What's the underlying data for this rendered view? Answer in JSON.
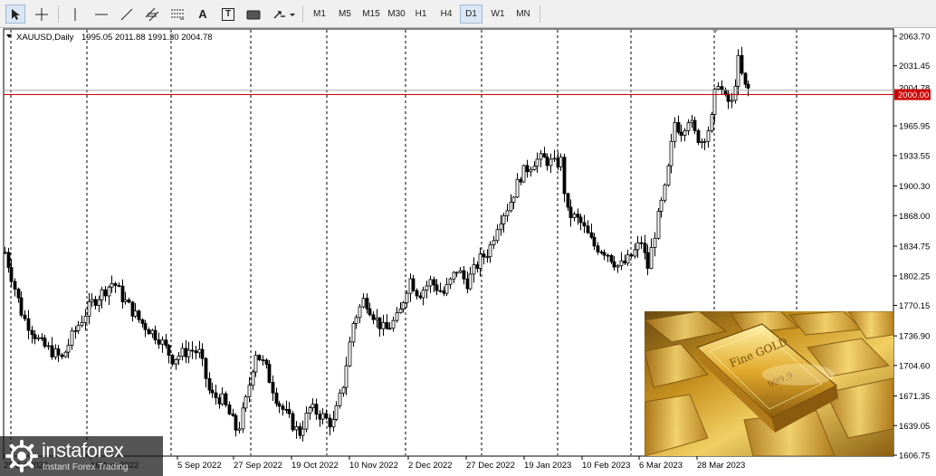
{
  "toolbar": {
    "tools": [
      "cursor-icon",
      "crosshair-icon",
      "vertical-line-icon",
      "horizontal-line-icon",
      "trendline-icon",
      "channel-icon",
      "fibonacci-icon",
      "text-icon",
      "text-label-icon",
      "shapes-icon",
      "arrows-icon"
    ],
    "text_tool_label": "A",
    "text_label_tool_label": "T",
    "timeframes": [
      "M1",
      "M5",
      "M15",
      "M30",
      "H1",
      "H4",
      "D1",
      "W1",
      "MN"
    ],
    "active_timeframe": "D1"
  },
  "chart_header": {
    "symbol": "XAUUSD,Daily",
    "ohlc": "1995.05 2011.88 1991.30 2004.78"
  },
  "chart_data": {
    "type": "candlestick",
    "symbol": "XAUUSD,Daily",
    "open": 1995.05,
    "high": 2011.88,
    "low": 1991.3,
    "close": 2004.78,
    "y_ticks": [
      2063.7,
      2031.45,
      1965.95,
      1933.55,
      1900.3,
      1868.0,
      1834.75,
      1802.25,
      1770.15,
      1736.9,
      1704.6,
      1671.35,
      1639.05,
      1606.75
    ],
    "y_ticks_labels": [
      "2063.70",
      "2031.45",
      "1965.95",
      "1933.55",
      "1900.30",
      "1868.00",
      "1834.75",
      "1802.25",
      "1770.15",
      "1736.90",
      "1704.60",
      "1671.35",
      "1639.05",
      "1606.75"
    ],
    "ylim": [
      1606.75,
      2063.7
    ],
    "x_tick_labels": [
      "25 Jul 2022",
      "16 Aug 2022",
      "5 Sep 2022",
      "27 Sep 2022",
      "19 Oct 2022",
      "10 Nov 2022",
      "2 Dec 2022",
      "27 Dec 2022",
      "19 Jan 2023",
      "10 Feb 2023",
      "6 Mar 2023",
      "28 Mar 2023"
    ],
    "level_line": 2000.0,
    "level_line_label": "2000.00",
    "last_price_label": "2004.78",
    "level_line_color": "#cc0000",
    "up_color": "#ffffff",
    "down_color": "#000000",
    "grid": "vertical dashed",
    "anchors": [
      {
        "x": 5,
        "y": 1828
      },
      {
        "x": 25,
        "y": 1758
      },
      {
        "x": 45,
        "y": 1728
      },
      {
        "x": 68,
        "y": 1712
      },
      {
        "x": 80,
        "y": 1738
      },
      {
        "x": 100,
        "y": 1772
      },
      {
        "x": 125,
        "y": 1796
      },
      {
        "x": 135,
        "y": 1778
      },
      {
        "x": 155,
        "y": 1752
      },
      {
        "x": 175,
        "y": 1735
      },
      {
        "x": 190,
        "y": 1712
      },
      {
        "x": 210,
        "y": 1722
      },
      {
        "x": 220,
        "y": 1718
      },
      {
        "x": 232,
        "y": 1672
      },
      {
        "x": 245,
        "y": 1668
      },
      {
        "x": 262,
        "y": 1632
      },
      {
        "x": 272,
        "y": 1668
      },
      {
        "x": 282,
        "y": 1720
      },
      {
        "x": 293,
        "y": 1702
      },
      {
        "x": 306,
        "y": 1666
      },
      {
        "x": 318,
        "y": 1648
      },
      {
        "x": 330,
        "y": 1630
      },
      {
        "x": 342,
        "y": 1658
      },
      {
        "x": 355,
        "y": 1650
      },
      {
        "x": 367,
        "y": 1640
      },
      {
        "x": 378,
        "y": 1680
      },
      {
        "x": 390,
        "y": 1752
      },
      {
        "x": 402,
        "y": 1778
      },
      {
        "x": 415,
        "y": 1755
      },
      {
        "x": 425,
        "y": 1742
      },
      {
        "x": 440,
        "y": 1758
      },
      {
        "x": 452,
        "y": 1800
      },
      {
        "x": 462,
        "y": 1782
      },
      {
        "x": 475,
        "y": 1796
      },
      {
        "x": 490,
        "y": 1783
      },
      {
        "x": 505,
        "y": 1810
      },
      {
        "x": 515,
        "y": 1794
      },
      {
        "x": 530,
        "y": 1820
      },
      {
        "x": 540,
        "y": 1830
      },
      {
        "x": 550,
        "y": 1862
      },
      {
        "x": 562,
        "y": 1880
      },
      {
        "x": 575,
        "y": 1912
      },
      {
        "x": 590,
        "y": 1928
      },
      {
        "x": 600,
        "y": 1930
      },
      {
        "x": 612,
        "y": 1924
      },
      {
        "x": 620,
        "y": 1928
      },
      {
        "x": 625,
        "y": 1872
      },
      {
        "x": 640,
        "y": 1862
      },
      {
        "x": 655,
        "y": 1836
      },
      {
        "x": 670,
        "y": 1828
      },
      {
        "x": 683,
        "y": 1812
      },
      {
        "x": 692,
        "y": 1818
      },
      {
        "x": 700,
        "y": 1828
      },
      {
        "x": 708,
        "y": 1840
      },
      {
        "x": 715,
        "y": 1810
      },
      {
        "x": 725,
        "y": 1860
      },
      {
        "x": 735,
        "y": 1900
      },
      {
        "x": 745,
        "y": 1970
      },
      {
        "x": 752,
        "y": 1960
      },
      {
        "x": 760,
        "y": 1975
      },
      {
        "x": 768,
        "y": 1955
      },
      {
        "x": 775,
        "y": 1950
      },
      {
        "x": 785,
        "y": 1968
      },
      {
        "x": 792,
        "y": 2018
      },
      {
        "x": 800,
        "y": 1995
      },
      {
        "x": 808,
        "y": 1990
      },
      {
        "x": 815,
        "y": 2038
      },
      {
        "x": 822,
        "y": 2008
      },
      {
        "x": 829,
        "y": 2004.78
      }
    ]
  },
  "watermark": {
    "brand": "instaforex",
    "tagline": "Instant Forex Trading"
  },
  "inset_image": {
    "bar_lettering": [
      "Fine GOLD",
      "999.9"
    ]
  },
  "colors": {
    "background": "#ffffff",
    "toolbar": "#f0f0f0",
    "gold": "#d4a017"
  }
}
